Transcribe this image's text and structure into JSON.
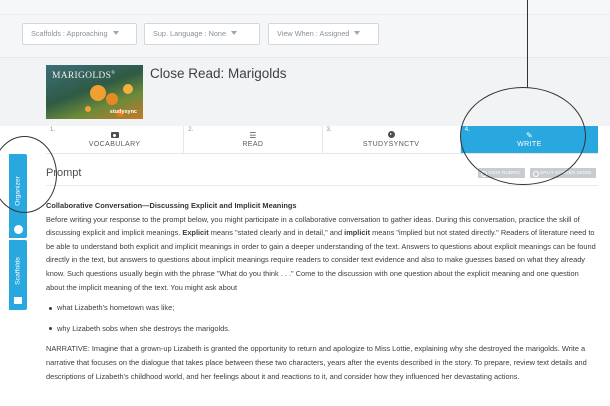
{
  "filters": {
    "scaffolds": "Scaffolds : Approaching",
    "sup_language": "Sup. Language : None",
    "view_when": "View When : Assigned"
  },
  "lesson": {
    "title": "Close Read: Marigolds",
    "cover_title": "MARIGOLDS",
    "cover_brand": "studysync"
  },
  "tabs": [
    {
      "num": "1.",
      "label": "VOCABULARY",
      "icon": "camera-icon"
    },
    {
      "num": "2.",
      "label": "READ",
      "icon": "list-icon"
    },
    {
      "num": "3.",
      "label": "STUDYSYNCTV",
      "icon": "play-circle-icon"
    },
    {
      "num": "4.",
      "label": "WRITE",
      "icon": "pencil-icon",
      "active": true
    }
  ],
  "side_tabs": {
    "organizer": "Organizer",
    "scaffolds": "Scaffolds"
  },
  "prompt": {
    "title": "Prompt",
    "view_rubric": "VIEW RUBRIC",
    "split_screen": "SPLIT SCREEN MODE",
    "heading": "Collaborative Conversation—Discussing Explicit and Implicit Meanings",
    "para1_a": "Before writing your response to the prompt below, you might participate in a collaborative conversation to gather ideas. During this conversation, practice the skill of discussing explicit and implicit meanings. ",
    "para1_explicit": "Explicit",
    "para1_b": " means \"stated clearly and in detail,\" and ",
    "para1_implicit": "implicit",
    "para1_c": " means \"implied but not stated directly.\" Readers of literature need to be able to understand both explicit and implicit meanings in order to gain a deeper understanding of the text. Answers to questions about explicit meanings can be found directly in the text, but answers to questions about implicit meanings require readers to consider text evidence and also to make guesses based on what they already know. Such questions usually begin with the phrase \"What do you think . . .\" Come to the discussion with one question about the explicit meaning and one question about the implicit meaning of the text. You might ask about",
    "bullets": [
      "what Lizabeth's hometown was like;",
      "why Lizabeth sobs when she destroys the marigolds."
    ],
    "narrative": "NARRATIVE: Imagine that a grown-up Lizabeth is granted the opportunity to return and apologize to Miss Lottie, explaining why she destroyed the marigolds. Write a narrative that focuses on the dialogue that takes place between these two characters, years after the events described in the story. To prepare, review text details and descriptions of Lizabeth's childhood world, and her feelings about it and reactions to it, and consider how they influenced her devastating actions."
  },
  "colors": {
    "accent": "#29a8e0"
  }
}
